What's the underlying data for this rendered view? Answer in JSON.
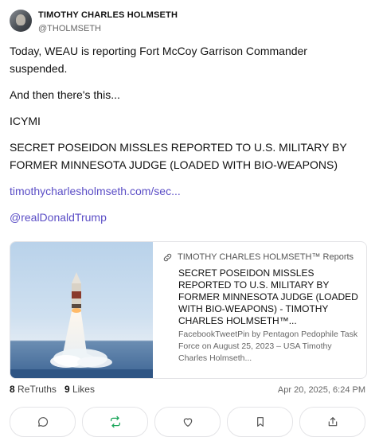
{
  "author": {
    "display_name": "TIMOTHY CHARLES HOLMSETH",
    "handle": "@THOLMSETH"
  },
  "post": {
    "paragraphs": [
      "Today, WEAU is reporting Fort McCoy Garrison Commander suspended.",
      "And then there's this...",
      "ICYMI",
      "SECRET POSEIDON MISSLES REPORTED TO U.S. MILITARY BY FORMER MINNESOTA JUDGE (LOADED WITH BIO-WEAPONS)"
    ],
    "link_text": "timothycharlesholmseth.com/sec...",
    "mention": "@realDonaldTrump"
  },
  "card": {
    "source": "TIMOTHY CHARLES HOLMSETH™ Reports",
    "title": "SECRET POSEIDON MISSLES REPORTED TO U.S. MILITARY BY FORMER MINNESOTA JUDGE (LOADED WITH BIO-WEAPONS) - TIMOTHY CHARLES HOLMSETH™...",
    "description": "FacebookTweetPin by Pentagon Pedophile Task Force on August 25, 2023 – USA Timothy Charles Holmseth..."
  },
  "stats": {
    "retruths_count": "8",
    "retruths_label": "ReTruths",
    "likes_count": "9",
    "likes_label": "Likes",
    "timestamp": "Apr 20, 2025, 6:24 PM"
  },
  "icons": [
    "reply-icon",
    "retruth-icon",
    "like-icon",
    "bookmark-icon",
    "share-icon",
    "link-icon"
  ],
  "colors": {
    "link": "#5b4ec6",
    "retruth_icon": "#18a558"
  }
}
